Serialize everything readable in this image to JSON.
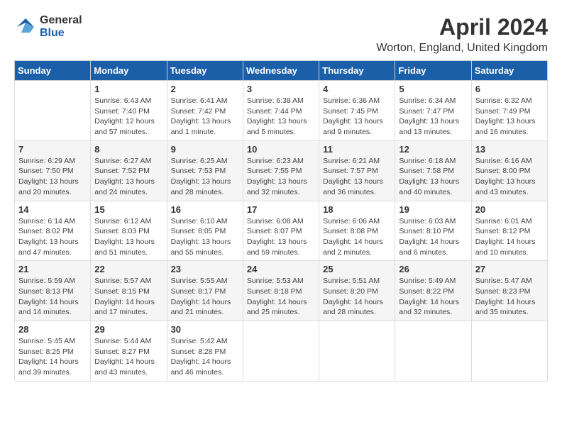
{
  "logo": {
    "general": "General",
    "blue": "Blue"
  },
  "title": "April 2024",
  "subtitle": "Worton, England, United Kingdom",
  "days_of_week": [
    "Sunday",
    "Monday",
    "Tuesday",
    "Wednesday",
    "Thursday",
    "Friday",
    "Saturday"
  ],
  "weeks": [
    [
      {
        "day": "",
        "info": ""
      },
      {
        "day": "1",
        "info": "Sunrise: 6:43 AM\nSunset: 7:40 PM\nDaylight: 12 hours\nand 57 minutes."
      },
      {
        "day": "2",
        "info": "Sunrise: 6:41 AM\nSunset: 7:42 PM\nDaylight: 13 hours\nand 1 minute."
      },
      {
        "day": "3",
        "info": "Sunrise: 6:38 AM\nSunset: 7:44 PM\nDaylight: 13 hours\nand 5 minutes."
      },
      {
        "day": "4",
        "info": "Sunrise: 6:36 AM\nSunset: 7:45 PM\nDaylight: 13 hours\nand 9 minutes."
      },
      {
        "day": "5",
        "info": "Sunrise: 6:34 AM\nSunset: 7:47 PM\nDaylight: 13 hours\nand 13 minutes."
      },
      {
        "day": "6",
        "info": "Sunrise: 6:32 AM\nSunset: 7:49 PM\nDaylight: 13 hours\nand 16 minutes."
      }
    ],
    [
      {
        "day": "7",
        "info": "Sunrise: 6:29 AM\nSunset: 7:50 PM\nDaylight: 13 hours\nand 20 minutes."
      },
      {
        "day": "8",
        "info": "Sunrise: 6:27 AM\nSunset: 7:52 PM\nDaylight: 13 hours\nand 24 minutes."
      },
      {
        "day": "9",
        "info": "Sunrise: 6:25 AM\nSunset: 7:53 PM\nDaylight: 13 hours\nand 28 minutes."
      },
      {
        "day": "10",
        "info": "Sunrise: 6:23 AM\nSunset: 7:55 PM\nDaylight: 13 hours\nand 32 minutes."
      },
      {
        "day": "11",
        "info": "Sunrise: 6:21 AM\nSunset: 7:57 PM\nDaylight: 13 hours\nand 36 minutes."
      },
      {
        "day": "12",
        "info": "Sunrise: 6:18 AM\nSunset: 7:58 PM\nDaylight: 13 hours\nand 40 minutes."
      },
      {
        "day": "13",
        "info": "Sunrise: 6:16 AM\nSunset: 8:00 PM\nDaylight: 13 hours\nand 43 minutes."
      }
    ],
    [
      {
        "day": "14",
        "info": "Sunrise: 6:14 AM\nSunset: 8:02 PM\nDaylight: 13 hours\nand 47 minutes."
      },
      {
        "day": "15",
        "info": "Sunrise: 6:12 AM\nSunset: 8:03 PM\nDaylight: 13 hours\nand 51 minutes."
      },
      {
        "day": "16",
        "info": "Sunrise: 6:10 AM\nSunset: 8:05 PM\nDaylight: 13 hours\nand 55 minutes."
      },
      {
        "day": "17",
        "info": "Sunrise: 6:08 AM\nSunset: 8:07 PM\nDaylight: 13 hours\nand 59 minutes."
      },
      {
        "day": "18",
        "info": "Sunrise: 6:06 AM\nSunset: 8:08 PM\nDaylight: 14 hours\nand 2 minutes."
      },
      {
        "day": "19",
        "info": "Sunrise: 6:03 AM\nSunset: 8:10 PM\nDaylight: 14 hours\nand 6 minutes."
      },
      {
        "day": "20",
        "info": "Sunrise: 6:01 AM\nSunset: 8:12 PM\nDaylight: 14 hours\nand 10 minutes."
      }
    ],
    [
      {
        "day": "21",
        "info": "Sunrise: 5:59 AM\nSunset: 8:13 PM\nDaylight: 14 hours\nand 14 minutes."
      },
      {
        "day": "22",
        "info": "Sunrise: 5:57 AM\nSunset: 8:15 PM\nDaylight: 14 hours\nand 17 minutes."
      },
      {
        "day": "23",
        "info": "Sunrise: 5:55 AM\nSunset: 8:17 PM\nDaylight: 14 hours\nand 21 minutes."
      },
      {
        "day": "24",
        "info": "Sunrise: 5:53 AM\nSunset: 8:18 PM\nDaylight: 14 hours\nand 25 minutes."
      },
      {
        "day": "25",
        "info": "Sunrise: 5:51 AM\nSunset: 8:20 PM\nDaylight: 14 hours\nand 28 minutes."
      },
      {
        "day": "26",
        "info": "Sunrise: 5:49 AM\nSunset: 8:22 PM\nDaylight: 14 hours\nand 32 minutes."
      },
      {
        "day": "27",
        "info": "Sunrise: 5:47 AM\nSunset: 8:23 PM\nDaylight: 14 hours\nand 35 minutes."
      }
    ],
    [
      {
        "day": "28",
        "info": "Sunrise: 5:45 AM\nSunset: 8:25 PM\nDaylight: 14 hours\nand 39 minutes."
      },
      {
        "day": "29",
        "info": "Sunrise: 5:44 AM\nSunset: 8:27 PM\nDaylight: 14 hours\nand 43 minutes."
      },
      {
        "day": "30",
        "info": "Sunrise: 5:42 AM\nSunset: 8:28 PM\nDaylight: 14 hours\nand 46 minutes."
      },
      {
        "day": "",
        "info": ""
      },
      {
        "day": "",
        "info": ""
      },
      {
        "day": "",
        "info": ""
      },
      {
        "day": "",
        "info": ""
      }
    ]
  ]
}
